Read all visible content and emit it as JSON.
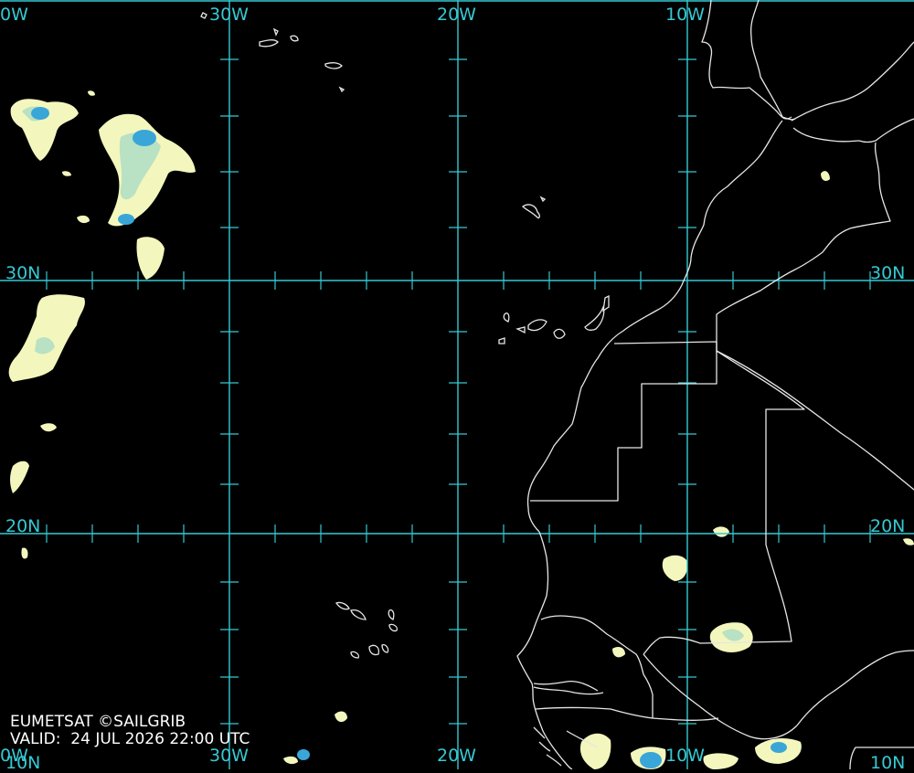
{
  "credit": "EUMETSAT ©SAILGRIB",
  "valid": "VALID:  24 JUL 2026 22:00 UTC",
  "colors": {
    "grid": "#35c9d3",
    "coast": "#e6e6e6",
    "cloud_light": "#f3f7bd",
    "cloud_mid": "#b9e1c3",
    "cloud_dark": "#3aa6d8"
  },
  "top_labels": [
    "0W",
    "30W",
    "20W",
    "10W"
  ],
  "bottom_labels": [
    "0W",
    "30W",
    "20W",
    "10W",
    "10N"
  ],
  "left_labels": [
    "30N",
    "20N",
    "10N"
  ],
  "right_labels": [
    "30N",
    "20N"
  ]
}
